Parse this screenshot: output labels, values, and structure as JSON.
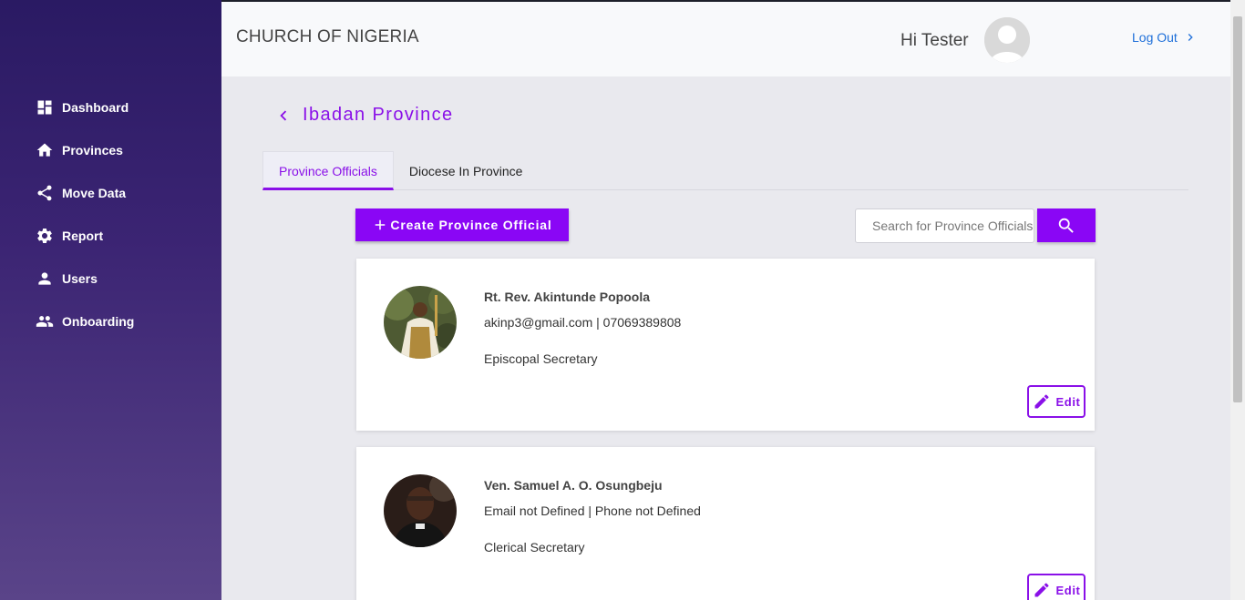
{
  "brand": "CHURCH OF NIGERIA",
  "header": {
    "greeting": "Hi Tester",
    "logout_label": "Log Out"
  },
  "sidebar": {
    "items": [
      {
        "label": "Dashboard",
        "icon": "dashboard-icon"
      },
      {
        "label": "Provinces",
        "icon": "home-icon"
      },
      {
        "label": "Move Data",
        "icon": "share-icon"
      },
      {
        "label": "Report",
        "icon": "gear-icon"
      },
      {
        "label": "Users",
        "icon": "person-icon"
      },
      {
        "label": "Onboarding",
        "icon": "group-icon"
      }
    ]
  },
  "page": {
    "title": "Ibadan Province",
    "tabs": [
      {
        "label": "Province Officials",
        "active": true
      },
      {
        "label": "Diocese In Province",
        "active": false
      }
    ],
    "create_button_label": "Create Province Official",
    "search_placeholder": "Search for Province Officials"
  },
  "officials": [
    {
      "name": "Rt. Rev. Akintunde Popoola",
      "contact": "akinp3@gmail.com | 07069389808",
      "role": "Episcopal Secretary",
      "edit_label": "Edit"
    },
    {
      "name": "Ven. Samuel A. O. Osungbeju",
      "contact": "Email not Defined | Phone not Defined",
      "role": "Clerical Secretary",
      "edit_label": "Edit"
    }
  ],
  "colors": {
    "accent": "#8a06f5",
    "sidebar_top": "#2a1a63",
    "sidebar_bottom": "#5a4489",
    "link": "#1e6fd9"
  }
}
